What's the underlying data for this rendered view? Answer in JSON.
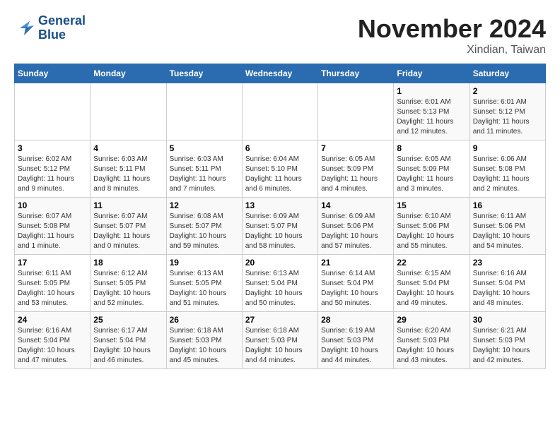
{
  "header": {
    "logo_line1": "General",
    "logo_line2": "Blue",
    "month_title": "November 2024",
    "location": "Xindian, Taiwan"
  },
  "weekdays": [
    "Sunday",
    "Monday",
    "Tuesday",
    "Wednesday",
    "Thursday",
    "Friday",
    "Saturday"
  ],
  "weeks": [
    [
      {
        "day": "",
        "info": ""
      },
      {
        "day": "",
        "info": ""
      },
      {
        "day": "",
        "info": ""
      },
      {
        "day": "",
        "info": ""
      },
      {
        "day": "",
        "info": ""
      },
      {
        "day": "1",
        "info": "Sunrise: 6:01 AM\nSunset: 5:13 PM\nDaylight: 11 hours and 12 minutes."
      },
      {
        "day": "2",
        "info": "Sunrise: 6:01 AM\nSunset: 5:12 PM\nDaylight: 11 hours and 11 minutes."
      }
    ],
    [
      {
        "day": "3",
        "info": "Sunrise: 6:02 AM\nSunset: 5:12 PM\nDaylight: 11 hours and 9 minutes."
      },
      {
        "day": "4",
        "info": "Sunrise: 6:03 AM\nSunset: 5:11 PM\nDaylight: 11 hours and 8 minutes."
      },
      {
        "day": "5",
        "info": "Sunrise: 6:03 AM\nSunset: 5:11 PM\nDaylight: 11 hours and 7 minutes."
      },
      {
        "day": "6",
        "info": "Sunrise: 6:04 AM\nSunset: 5:10 PM\nDaylight: 11 hours and 6 minutes."
      },
      {
        "day": "7",
        "info": "Sunrise: 6:05 AM\nSunset: 5:09 PM\nDaylight: 11 hours and 4 minutes."
      },
      {
        "day": "8",
        "info": "Sunrise: 6:05 AM\nSunset: 5:09 PM\nDaylight: 11 hours and 3 minutes."
      },
      {
        "day": "9",
        "info": "Sunrise: 6:06 AM\nSunset: 5:08 PM\nDaylight: 11 hours and 2 minutes."
      }
    ],
    [
      {
        "day": "10",
        "info": "Sunrise: 6:07 AM\nSunset: 5:08 PM\nDaylight: 11 hours and 1 minute."
      },
      {
        "day": "11",
        "info": "Sunrise: 6:07 AM\nSunset: 5:07 PM\nDaylight: 11 hours and 0 minutes."
      },
      {
        "day": "12",
        "info": "Sunrise: 6:08 AM\nSunset: 5:07 PM\nDaylight: 10 hours and 59 minutes."
      },
      {
        "day": "13",
        "info": "Sunrise: 6:09 AM\nSunset: 5:07 PM\nDaylight: 10 hours and 58 minutes."
      },
      {
        "day": "14",
        "info": "Sunrise: 6:09 AM\nSunset: 5:06 PM\nDaylight: 10 hours and 57 minutes."
      },
      {
        "day": "15",
        "info": "Sunrise: 6:10 AM\nSunset: 5:06 PM\nDaylight: 10 hours and 55 minutes."
      },
      {
        "day": "16",
        "info": "Sunrise: 6:11 AM\nSunset: 5:06 PM\nDaylight: 10 hours and 54 minutes."
      }
    ],
    [
      {
        "day": "17",
        "info": "Sunrise: 6:11 AM\nSunset: 5:05 PM\nDaylight: 10 hours and 53 minutes."
      },
      {
        "day": "18",
        "info": "Sunrise: 6:12 AM\nSunset: 5:05 PM\nDaylight: 10 hours and 52 minutes."
      },
      {
        "day": "19",
        "info": "Sunrise: 6:13 AM\nSunset: 5:05 PM\nDaylight: 10 hours and 51 minutes."
      },
      {
        "day": "20",
        "info": "Sunrise: 6:13 AM\nSunset: 5:04 PM\nDaylight: 10 hours and 50 minutes."
      },
      {
        "day": "21",
        "info": "Sunrise: 6:14 AM\nSunset: 5:04 PM\nDaylight: 10 hours and 50 minutes."
      },
      {
        "day": "22",
        "info": "Sunrise: 6:15 AM\nSunset: 5:04 PM\nDaylight: 10 hours and 49 minutes."
      },
      {
        "day": "23",
        "info": "Sunrise: 6:16 AM\nSunset: 5:04 PM\nDaylight: 10 hours and 48 minutes."
      }
    ],
    [
      {
        "day": "24",
        "info": "Sunrise: 6:16 AM\nSunset: 5:04 PM\nDaylight: 10 hours and 47 minutes."
      },
      {
        "day": "25",
        "info": "Sunrise: 6:17 AM\nSunset: 5:04 PM\nDaylight: 10 hours and 46 minutes."
      },
      {
        "day": "26",
        "info": "Sunrise: 6:18 AM\nSunset: 5:03 PM\nDaylight: 10 hours and 45 minutes."
      },
      {
        "day": "27",
        "info": "Sunrise: 6:18 AM\nSunset: 5:03 PM\nDaylight: 10 hours and 44 minutes."
      },
      {
        "day": "28",
        "info": "Sunrise: 6:19 AM\nSunset: 5:03 PM\nDaylight: 10 hours and 44 minutes."
      },
      {
        "day": "29",
        "info": "Sunrise: 6:20 AM\nSunset: 5:03 PM\nDaylight: 10 hours and 43 minutes."
      },
      {
        "day": "30",
        "info": "Sunrise: 6:21 AM\nSunset: 5:03 PM\nDaylight: 10 hours and 42 minutes."
      }
    ]
  ]
}
